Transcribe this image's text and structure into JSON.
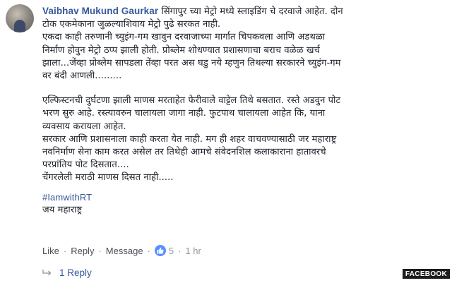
{
  "comment": {
    "author": "Vaibhav Mukund Gaurkar",
    "first_line": "सिंगापुर च्या मेट्रो मध्ये स्लाइडिंग चे दरवाजे आहेत. दोन",
    "para1": [
      "टोक एकमेकाना जुळल्याशिवाय मेट्रो पुढे सरकत नाही.",
      "एकदा काही तरुणानी च्युइंग-गम खावुन दरवाजाच्या मार्गात चिपकवला आणि अडथळा",
      "निर्माण होवुन मेट्रो ठप्प झाली होती. प्रोब्लेम शोधण्यात प्रशासणाचा बराच वळेळ खर्च",
      "झाला...जेंव्हा प्रोब्लेम सापडला तेंव्हा परत अस घडु नये म्हणुन तिथल्या सरकारने च्युइंग-गम",
      "वर बंदी आणली........."
    ],
    "para2": [
      "एल्फिस्टनची दुर्घटणा झाली माणस मरताहेत फेरीवाले वाट्टेल तिथे बसतात. रस्ते अडवुन पोट",
      "भरण सुरु आहे. रस्त्यावरुन चालायला जागा नाही. फुटपाथ चालायला आहेत कि, याना",
      "व्यवसाय करायला आहेत.",
      "सरकार आणि प्रशासनाला काही करता येत नाही. मग ही शहर वाचवण्यासाठी जर महाराष्ट्र",
      "नवनिर्माण सेना काम करत असेल तर तिथेही आमचे संवेदनशिल कलाकाराना हातावरचे",
      "परप्रांतिय पोट दिसतात....",
      "चेंगरलेली मराठी माणस दिसत नाही....."
    ],
    "hashtag": "#IamwithRT",
    "closing": "जय महाराष्ट्र"
  },
  "actions": {
    "like": "Like",
    "reply": "Reply",
    "message": "Message",
    "separator": "·",
    "reaction_icon": "like-thumb-icon",
    "reaction_count": "5",
    "timestamp": "1 hr"
  },
  "replies": {
    "label": "1 Reply"
  },
  "watermark": "FACEBOOK",
  "colors": {
    "link_blue": "#365899",
    "meta_gray": "#90949c",
    "reaction_blue": "#5890ff"
  }
}
